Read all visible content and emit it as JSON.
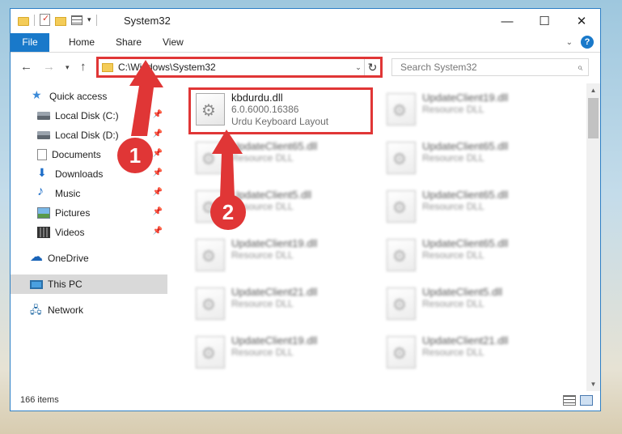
{
  "window": {
    "title": "System32",
    "controls": {
      "minimize": "—",
      "maximize": "☐",
      "close": "✕"
    }
  },
  "ribbon": {
    "tabs": [
      "File",
      "Home",
      "Share",
      "View"
    ],
    "expand_label": "⌄",
    "help_label": "?"
  },
  "nav": {
    "back_label": "←",
    "forward_label": "→",
    "recent_label": "▾",
    "up_label": "↑",
    "address_path": "C:\\Windows\\System32",
    "address_drop_label": "⌄",
    "refresh_label": "↻",
    "search_placeholder": "Search System32",
    "search_icon_label": "⌕"
  },
  "sidebar": {
    "items": [
      {
        "label": "Quick access",
        "icon": "star-icon",
        "pinned": false,
        "selected": false
      },
      {
        "label": "Local Disk (C:)",
        "icon": "drive-icon",
        "pinned": true,
        "selected": false
      },
      {
        "label": "Local Disk (D:)",
        "icon": "drive-icon",
        "pinned": true,
        "selected": false
      },
      {
        "label": "Documents",
        "icon": "documents-icon",
        "pinned": true,
        "selected": false
      },
      {
        "label": "Downloads",
        "icon": "download-icon",
        "pinned": true,
        "selected": false
      },
      {
        "label": "Music",
        "icon": "music-icon",
        "pinned": true,
        "selected": false
      },
      {
        "label": "Pictures",
        "icon": "pictures-icon",
        "pinned": true,
        "selected": false
      },
      {
        "label": "Videos",
        "icon": "videos-icon",
        "pinned": true,
        "selected": false
      },
      {
        "label": "OneDrive",
        "icon": "onedrive-icon",
        "pinned": false,
        "selected": false
      },
      {
        "label": "This PC",
        "icon": "computer-icon",
        "pinned": false,
        "selected": true
      },
      {
        "label": "Network",
        "icon": "network-icon",
        "pinned": false,
        "selected": false
      }
    ],
    "pin_label": "📌"
  },
  "content": {
    "files": [
      {
        "name": "kbdurdu.dll",
        "version": "6.0.6000.16386",
        "description": "Urdu Keyboard Layout"
      },
      {
        "name": "UpdateClient19.dll",
        "description": "Resource DLL"
      },
      {
        "name": "UpdateClient65.dll",
        "description": "Resource DLL"
      },
      {
        "name": "UpdateClient65.dll",
        "description": "Resource DLL"
      },
      {
        "name": "UpdateClient5.dll",
        "description": "Resource DLL"
      },
      {
        "name": "UpdateClient65.dll",
        "description": "Resource DLL"
      },
      {
        "name": "UpdateClient19.dll",
        "description": "Resource DLL"
      },
      {
        "name": "UpdateClient65.dll",
        "description": "Resource DLL"
      },
      {
        "name": "UpdateClient21.dll",
        "description": "Resource DLL"
      },
      {
        "name": "UpdateClient5.dll",
        "description": "Resource DLL"
      },
      {
        "name": "UpdateClient19.dll",
        "description": "Resource DLL"
      },
      {
        "name": "UpdateClient21.dll",
        "description": "Resource DLL"
      }
    ]
  },
  "scrollbar": {
    "up_label": "▲",
    "down_label": "▼"
  },
  "status": {
    "item_count": "166 items"
  },
  "annotations": {
    "step1": "1",
    "step2": "2",
    "color": "#e03636"
  }
}
